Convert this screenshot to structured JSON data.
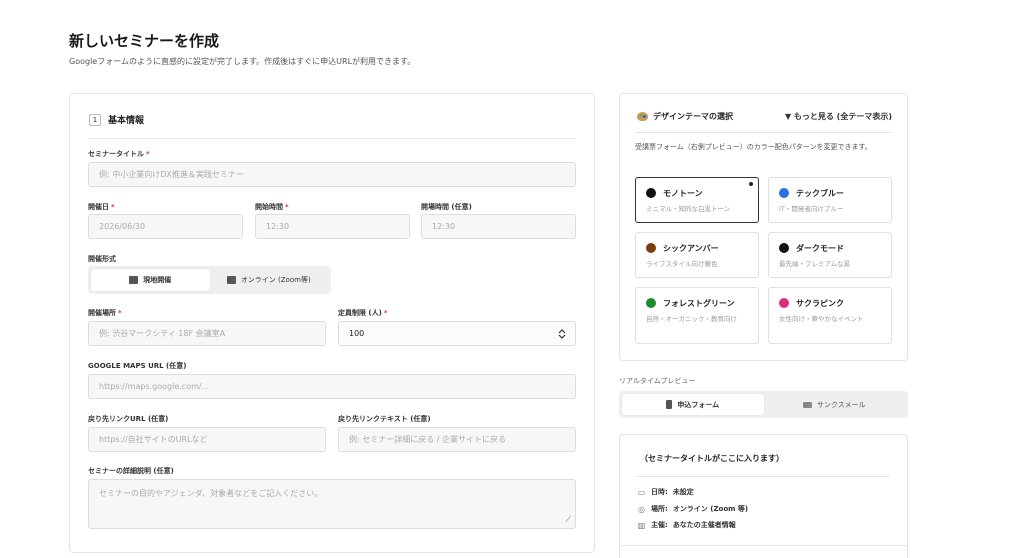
{
  "page": {
    "title": "新しいセミナーを作成",
    "subtitle": "Googleフォームのように直感的に設定が完了します。作成後はすぐに申込URLが利用できます。"
  },
  "basic": {
    "step": "1",
    "title": "基本情報",
    "seminar_title": {
      "label": "セミナータイトル",
      "placeholder": "例: 中小企業向けDX推進＆実践セミナー"
    },
    "date": {
      "label": "開催日",
      "value": "2026/06/30"
    },
    "start_time": {
      "label": "開始時間",
      "value": "12:30"
    },
    "open_time": {
      "label": "開場時間 (任意)",
      "value": "12:30"
    },
    "format": {
      "label": "開催形式",
      "options": [
        "現地開催",
        "オンライン (Zoom等)"
      ],
      "selected": "現地開催"
    },
    "venue": {
      "label": "開催場所",
      "placeholder": "例: 渋谷マークシティ 18F 会議室A"
    },
    "capacity": {
      "label": "定員制限 (人)",
      "value": "100"
    },
    "maps_url": {
      "label": "GOOGLE MAPS URL (任意)",
      "placeholder": "https://maps.google.com/..."
    },
    "return_url": {
      "label": "戻り先リンクURL (任意)",
      "placeholder": "https://自社サイトのURLなど"
    },
    "return_text": {
      "label": "戻り先リンクテキスト (任意)",
      "placeholder": "例: セミナー詳細に戻る / 企業サイトに戻る"
    },
    "description": {
      "label": "セミナーの詳細説明 (任意)",
      "placeholder": "セミナーの目的やアジェンダ、対象者などをご記入ください。"
    }
  },
  "theme": {
    "title": "デザインテーマの選択",
    "more": "▼ もっと見る (全テーマ表示)",
    "description": "受講票フォーム（右側プレビュー）のカラー配色パターンを変更できます。",
    "options": [
      {
        "name": "モノトーン",
        "desc": "ミニマル・知的な白黒トーン",
        "color": "#111111"
      },
      {
        "name": "テックブルー",
        "desc": "IT・開発者向けブルー",
        "color": "#2f6fe4"
      },
      {
        "name": "シックアンバー",
        "desc": "ライフスタイル向け暖色",
        "color": "#7a3c12"
      },
      {
        "name": "ダークモード",
        "desc": "最先端・プレミアムな黒",
        "color": "#111111"
      },
      {
        "name": "フォレストグリーン",
        "desc": "自然・オーガニック・教育向け",
        "color": "#1f8a2e"
      },
      {
        "name": "サクラピンク",
        "desc": "女性向け・華やかなイベント",
        "color": "#d8307a"
      }
    ],
    "selected": "モノトーン"
  },
  "preview": {
    "label": "リアルタイムプレビュー",
    "tabs": [
      "申込フォーム",
      "サンクスメール"
    ],
    "active_tab": "申込フォーム",
    "card_title": "（セミナータイトルがここに入ります）",
    "rows": [
      {
        "key": "日時:",
        "value": "未設定"
      },
      {
        "key": "場所:",
        "value": "オンライン (Zoom 等)"
      },
      {
        "key": "主催:",
        "value": "あなたの主催者情報"
      }
    ]
  },
  "colors": {
    "required": "#d23a3a",
    "accent": "#222222"
  }
}
